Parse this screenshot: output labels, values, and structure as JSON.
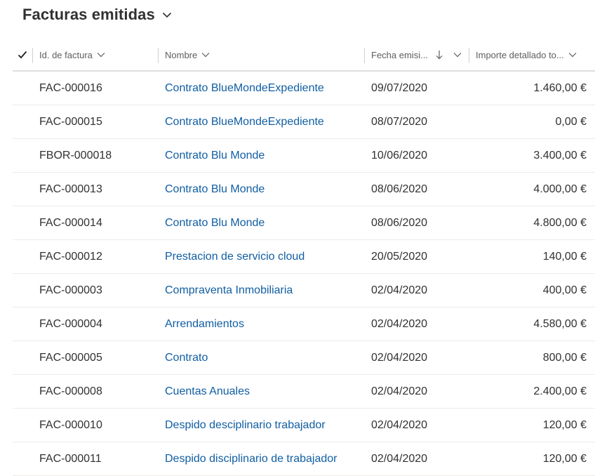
{
  "view": {
    "title": "Facturas emitidas"
  },
  "columns": {
    "id": "Id. de factura",
    "name": "Nombre",
    "date": "Fecha emisi...",
    "amount": "Importe detallado to..."
  },
  "rows": [
    {
      "id": "FAC-000016",
      "name": "Contrato BlueMondeExpediente",
      "date": "09/07/2020",
      "amount": "1.460,00 €"
    },
    {
      "id": "FAC-000015",
      "name": "Contrato BlueMondeExpediente",
      "date": "08/07/2020",
      "amount": "0,00 €"
    },
    {
      "id": "FBOR-000018",
      "name": "Contrato Blu Monde",
      "date": "10/06/2020",
      "amount": "3.400,00 €"
    },
    {
      "id": "FAC-000013",
      "name": "Contrato Blu Monde",
      "date": "08/06/2020",
      "amount": "4.000,00 €"
    },
    {
      "id": "FAC-000014",
      "name": "Contrato Blu Monde",
      "date": "08/06/2020",
      "amount": "4.800,00 €"
    },
    {
      "id": "FAC-000012",
      "name": "Prestacion de servicio cloud",
      "date": "20/05/2020",
      "amount": "140,00 €"
    },
    {
      "id": "FAC-000003",
      "name": "Compraventa Inmobiliaria",
      "date": "02/04/2020",
      "amount": "400,00 €"
    },
    {
      "id": "FAC-000004",
      "name": "Arrendamientos",
      "date": "02/04/2020",
      "amount": "4.580,00 €"
    },
    {
      "id": "FAC-000005",
      "name": "Contrato",
      "date": "02/04/2020",
      "amount": "800,00 €"
    },
    {
      "id": "FAC-000008",
      "name": "Cuentas Anuales",
      "date": "02/04/2020",
      "amount": "2.400,00 €"
    },
    {
      "id": "FAC-000010",
      "name": "Despido desciplinario trabajador",
      "date": "02/04/2020",
      "amount": "120,00 €"
    },
    {
      "id": "FAC-000011",
      "name": "Despido disciplinario de trabajador",
      "date": "02/04/2020",
      "amount": "120,00 €"
    }
  ]
}
